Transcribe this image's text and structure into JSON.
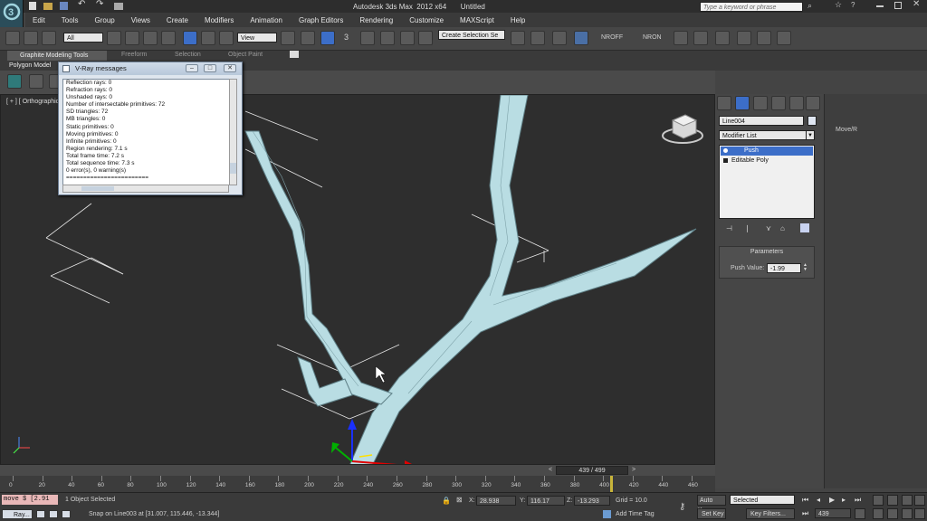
{
  "window": {
    "title": "Autodesk 3ds Max  2012 x64       Untitled",
    "search_placeholder": "Type a keyword or phrase"
  },
  "menu": [
    "Edit",
    "Tools",
    "Group",
    "Views",
    "Create",
    "Modifiers",
    "Animation",
    "Graph Editors",
    "Rendering",
    "Customize",
    "MAXScript",
    "Help"
  ],
  "toolbar": {
    "selection_filter": "All",
    "reference_coord": "View",
    "selection_set": "Create Selection Se",
    "nroff": "NROFF",
    "nron": "NRON",
    "three_label": "3"
  },
  "ribbon": {
    "tabs": [
      "Graphite Modeling Tools",
      "Freeform",
      "Selection",
      "Object Paint"
    ],
    "active_tab": "Graphite Modeling Tools",
    "sub_label": "Polygon Model"
  },
  "viewport": {
    "label": "[ + ] [ Orthographic ]"
  },
  "vray": {
    "title": "V-Ray messages",
    "lines": [
      "Reflection rays: 0",
      "Refraction rays: 0",
      "Unshaded rays: 0",
      "Number of intersectable primitives: 72",
      "  SD triangles: 72",
      "  MB triangles: 0",
      "  Static primitives: 0",
      "  Moving primitives: 0",
      "  Infinite primitives: 0",
      "Region rendering: 7.1 s",
      "Total frame time: 7.2 s",
      "Total sequence time: 7.3 s",
      "0 error(s), 0 warning(s)",
      "========================"
    ]
  },
  "command_panel": {
    "object_name": "Line004",
    "modifier_list": "Modifier List",
    "stack": [
      "Push",
      "Editable Poly"
    ],
    "rollout_title": "Parameters",
    "push_label": "Push Value:",
    "push_value": "-1.99"
  },
  "right_panel": {
    "label": "Move/R"
  },
  "timeline": {
    "frame_display": "439 / 499",
    "ticks": [
      "0",
      "20",
      "40",
      "60",
      "80",
      "100",
      "120",
      "140",
      "160",
      "180",
      "200",
      "220",
      "240",
      "260",
      "280",
      "300",
      "320",
      "340",
      "360",
      "380",
      "400",
      "420",
      "440",
      "460"
    ],
    "frame_fraction": 0.8798
  },
  "status": {
    "script_text": "move $ [2.91",
    "selection_info": "1 Object Selected",
    "prompt": "Snap on Line003 at [31.007, 115.446, -13.344]",
    "x_label": "X:",
    "x_value": "28.938",
    "y_label": "Y:",
    "y_value": "116.17",
    "z_label": "Z:",
    "z_value": "-13.293",
    "grid": "Grid = 10.0",
    "add_time_tag": "Add Time Tag",
    "auto_key": "Auto Key",
    "set_key": "Set Key",
    "key_mode": "Selected",
    "key_filters": "Key Filters...",
    "current_frame": "439",
    "taskbar_label": "Ray..."
  },
  "colors": {
    "branch": "#b9dde3",
    "viewport_bg": "#2e2e2e",
    "ui_dark": "#3a3a3a",
    "highlight": "#3c6ec8"
  }
}
